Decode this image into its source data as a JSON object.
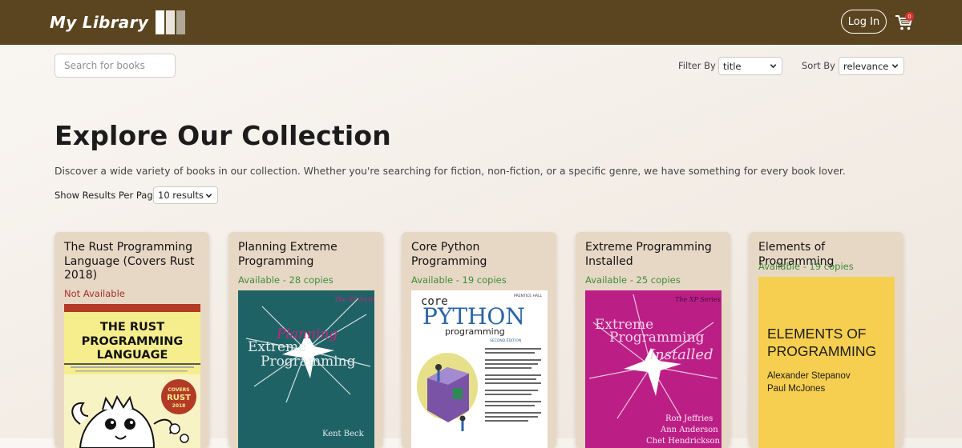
{
  "brand": {
    "name": "My Library",
    "bar_colors": [
      "#ffffff",
      "#e9e4dc",
      "#b0a796"
    ]
  },
  "header": {
    "login_label": "Log In",
    "cart_count": "0"
  },
  "search": {
    "placeholder": "Search for books"
  },
  "filter": {
    "label": "Filter By :",
    "value": "title"
  },
  "sort": {
    "label": "Sort By :",
    "value": "relevance"
  },
  "hero": {
    "title": "Explore Our Collection",
    "description": "Discover a wide variety of books in our collection. Whether you're searching for fiction, non-fiction, or a specific genre, we have something for every book lover."
  },
  "per_page": {
    "label": "Show Results Per Page:",
    "value": "10 results"
  },
  "books": [
    {
      "title": "The Rust Programming Language (Covers Rust 2018)",
      "status": "Not Available",
      "available": false,
      "cover": {
        "line1": "THE RUST",
        "line2": "PROGRAMMING",
        "line3": "LANGUAGE",
        "badge_top": "COVERS",
        "badge_mid": "RUST",
        "badge_bot": "2018"
      }
    },
    {
      "title": "Planning Extreme Programming",
      "status": "Available - 28 copies",
      "available": true,
      "cover": {
        "series": "The XP Series",
        "word1": "Planning",
        "word2": "Extreme",
        "word3": "Programming",
        "author": "Kent Beck"
      }
    },
    {
      "title": "Core Python Programming",
      "status": "Available - 19 copies",
      "available": true,
      "cover": {
        "publisher": "PRENTICE HALL",
        "word1": "core",
        "word2": "PYTHON",
        "word3": "programming",
        "edition": "SECOND EDITION"
      }
    },
    {
      "title": "Extreme Programming Installed",
      "status": "Available - 25 copies",
      "available": true,
      "cover": {
        "series": "The XP Series",
        "word1": "Extreme",
        "word2": "Programming",
        "word3": "Installed",
        "author1": "Ron Jeffries",
        "author2": "Ann Anderson",
        "author3": "Chet Hendrickson"
      }
    },
    {
      "title": "Elements of Programming",
      "status": "Available - 19 copies",
      "available": true,
      "cover": {
        "line1": "ELEMENTS OF",
        "line2": "PROGRAMMING",
        "author1": "Alexander Stepanov",
        "author2": "Paul McJones"
      }
    }
  ],
  "colors": {
    "header_bg": "#5b4520",
    "card_bg": "#e7d8c6",
    "available": "#3f8d3a",
    "unavailable": "#a8302b",
    "badge": "#d9302c"
  }
}
